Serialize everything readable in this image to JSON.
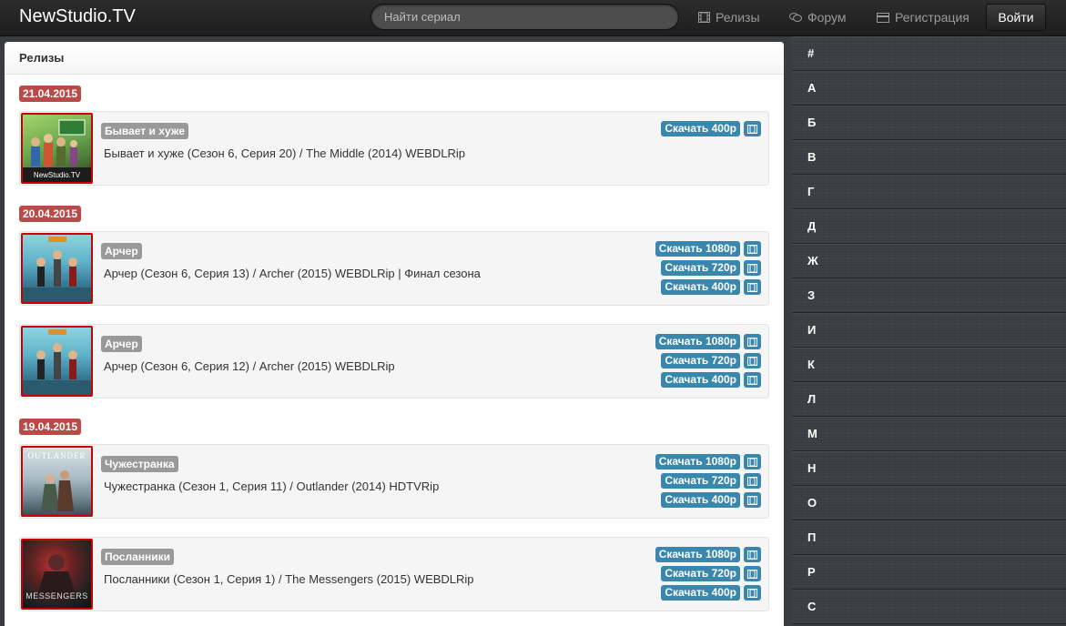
{
  "navbar": {
    "brand": "NewStudio.TV",
    "search_placeholder": "Найти сериал",
    "links": [
      {
        "label": "Релизы",
        "icon": "film-icon"
      },
      {
        "label": "Форум",
        "icon": "comments-icon"
      },
      {
        "label": "Регистрация",
        "icon": "card-icon"
      }
    ],
    "login_label": "Войти"
  },
  "main": {
    "title": "Релизы",
    "groups": [
      {
        "date": "21.04.2015"
      },
      {
        "date": "20.04.2015"
      },
      {
        "date": "19.04.2015"
      }
    ],
    "releases": [
      {
        "show": "Бывает и хуже",
        "title": "Бывает и хуже (Сезон 6, Серия 20) / The Middle (2014) WEBDLRip",
        "poster_text": "NewStudio.TV",
        "downloads": [
          "Скачать 400p"
        ]
      },
      {
        "show": "Арчер",
        "title": "Арчер (Сезон 6, Серия 13) / Archer (2015) WEBDLRip | Финал сезона",
        "poster_text": "",
        "downloads": [
          "Скачать 1080p",
          "Скачать 720p",
          "Скачать 400p"
        ]
      },
      {
        "show": "Арчер",
        "title": "Арчер (Сезон 6, Серия 12) / Archer (2015) WEBDLRip",
        "poster_text": "",
        "downloads": [
          "Скачать 1080p",
          "Скачать 720p",
          "Скачать 400p"
        ]
      },
      {
        "show": "Чужестранка",
        "title": "Чужестранка (Сезон 1, Серия 11) / Outlander (2014) HDTVRip",
        "poster_text": "OUTLANDER",
        "downloads": [
          "Скачать 1080p",
          "Скачать 720p",
          "Скачать 400p"
        ]
      },
      {
        "show": "Посланники",
        "title": "Посланники (Сезон 1, Серия 1) / The Messengers (2015) WEBDLRip",
        "poster_text": "MESSENGERS",
        "downloads": [
          "Скачать 1080p",
          "Скачать 720p",
          "Скачать 400p"
        ]
      }
    ]
  },
  "sidebar": {
    "letters": [
      "#",
      "А",
      "Б",
      "В",
      "Г",
      "Д",
      "Ж",
      "З",
      "И",
      "К",
      "Л",
      "М",
      "Н",
      "О",
      "П",
      "Р",
      "С"
    ]
  },
  "colors": {
    "date_badge": "#b94a48",
    "download_button": "#3a87ad",
    "show_label": "#999999",
    "poster_border": "#cc0000"
  }
}
